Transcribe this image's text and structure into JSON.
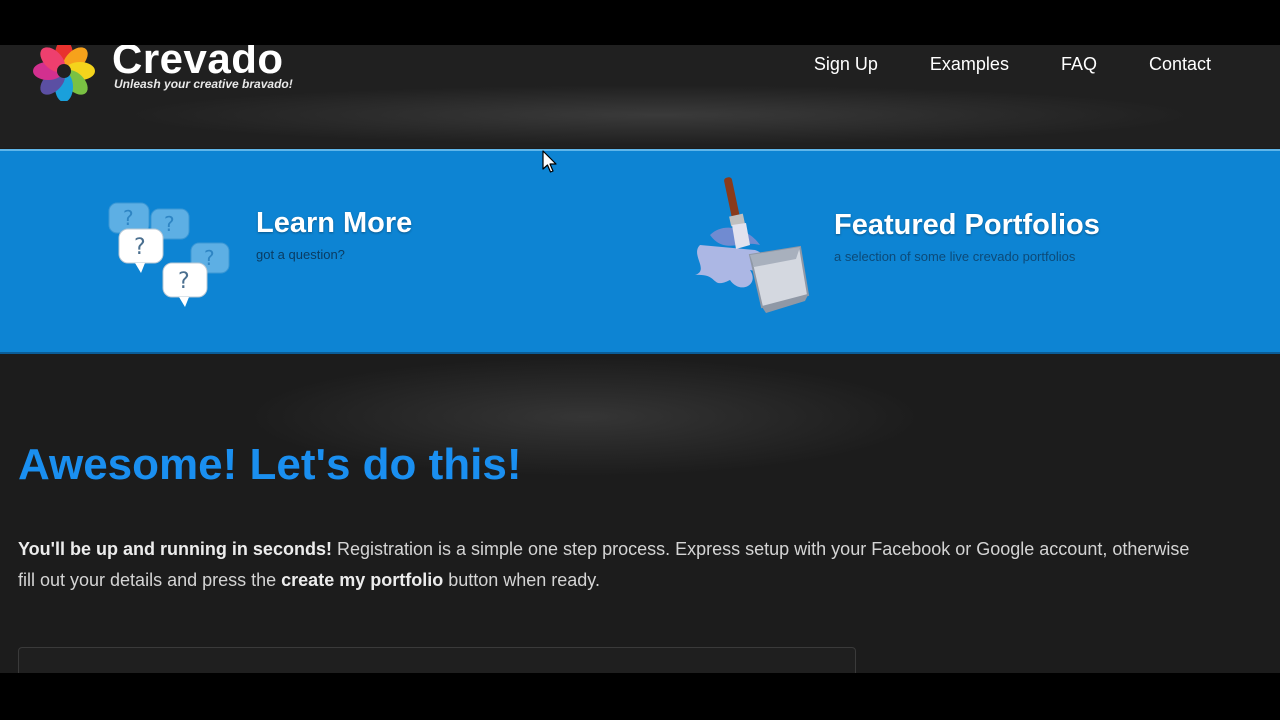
{
  "header": {
    "logo_name": "Crevado",
    "logo_tagline": "Unleash your creative bravado!",
    "nav": [
      {
        "label": "Sign Up"
      },
      {
        "label": "Examples"
      },
      {
        "label": "FAQ"
      },
      {
        "label": "Contact"
      }
    ]
  },
  "banner": {
    "learn_more": {
      "title": "Learn More",
      "subtitle": "got a question?",
      "icon": "question-bubbles-icon"
    },
    "featured": {
      "title": "Featured Portfolios",
      "subtitle": "a selection of some live crevado portfolios",
      "icon": "paint-bucket-icon"
    }
  },
  "content": {
    "heading": "Awesome! Let's do this!",
    "intro_bold_1": "You'll be up and running in seconds!",
    "intro_text_1": " Registration is a simple one step process. Express setup with your Facebook or Google account, otherwise fill out your details and press the ",
    "intro_bold_2": "create my portfolio",
    "intro_text_2": " button when ready."
  },
  "colors": {
    "page_background": "#1c1c1c",
    "banner_blue": "#0d84d3",
    "heading_blue": "#1a8ff0",
    "text": "#d4d4d4"
  }
}
